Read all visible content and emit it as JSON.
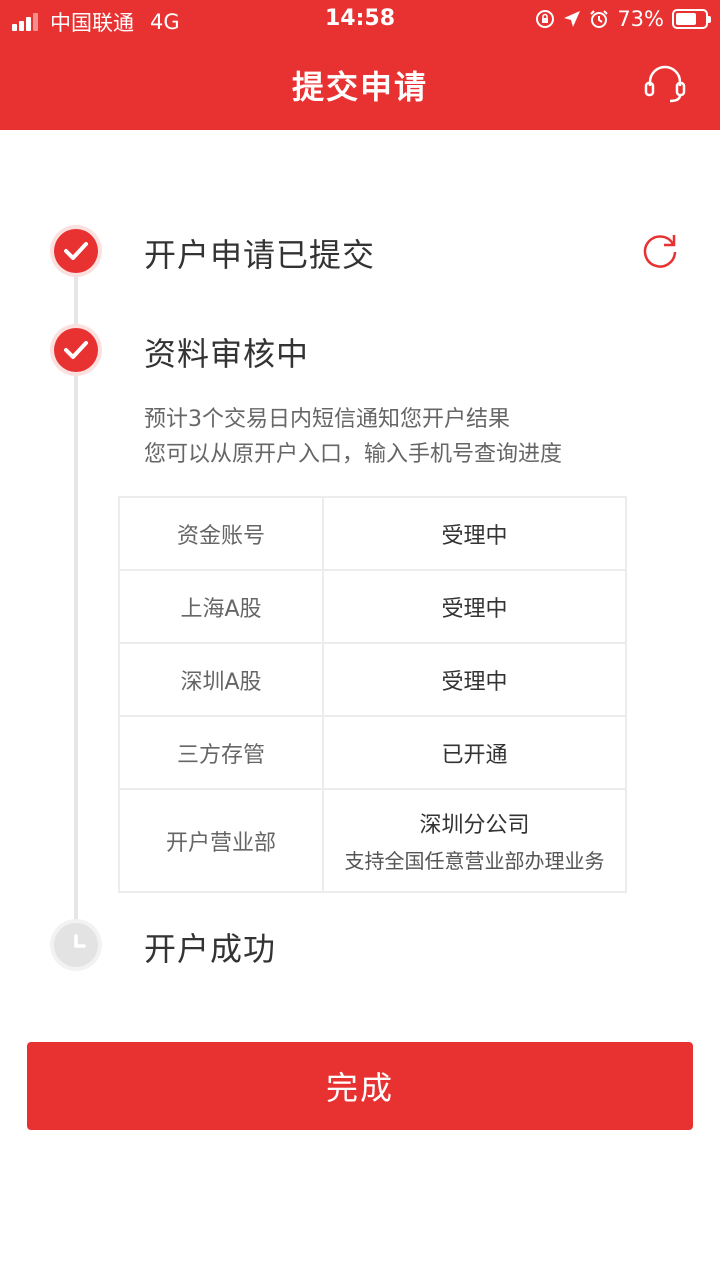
{
  "status_bar": {
    "carrier": "中国联通",
    "network": "4G",
    "time": "14:58",
    "battery": "73%",
    "battery_level": 0.73
  },
  "header": {
    "title": "提交申请"
  },
  "steps": [
    {
      "title": "开户申请已提交",
      "state": "done"
    },
    {
      "title": "资料审核中",
      "state": "done"
    },
    {
      "title": "开户成功",
      "state": "pending"
    }
  ],
  "review": {
    "lines": [
      "预计3个交易日内短信通知您开户结果",
      "您可以从原开户入口，输入手机号查询进度"
    ]
  },
  "table": {
    "rows": [
      {
        "label": "资金账号",
        "value": "受理中"
      },
      {
        "label": "上海A股",
        "value": "受理中"
      },
      {
        "label": "深圳A股",
        "value": "受理中"
      },
      {
        "label": "三方存管",
        "value": "已开通"
      },
      {
        "label": "开户营业部",
        "value": "深圳分公司",
        "sub": "支持全国任意营业部办理业务"
      }
    ]
  },
  "footer": {
    "done_label": "完成"
  },
  "colors": {
    "accent": "#e83232",
    "pending": "#e3e3e3"
  },
  "icons": [
    "signal-icon",
    "lock-rotation-icon",
    "location-arrow-icon",
    "alarm-icon",
    "battery-icon",
    "headset-icon",
    "refresh-icon",
    "check-icon",
    "clock-icon"
  ]
}
